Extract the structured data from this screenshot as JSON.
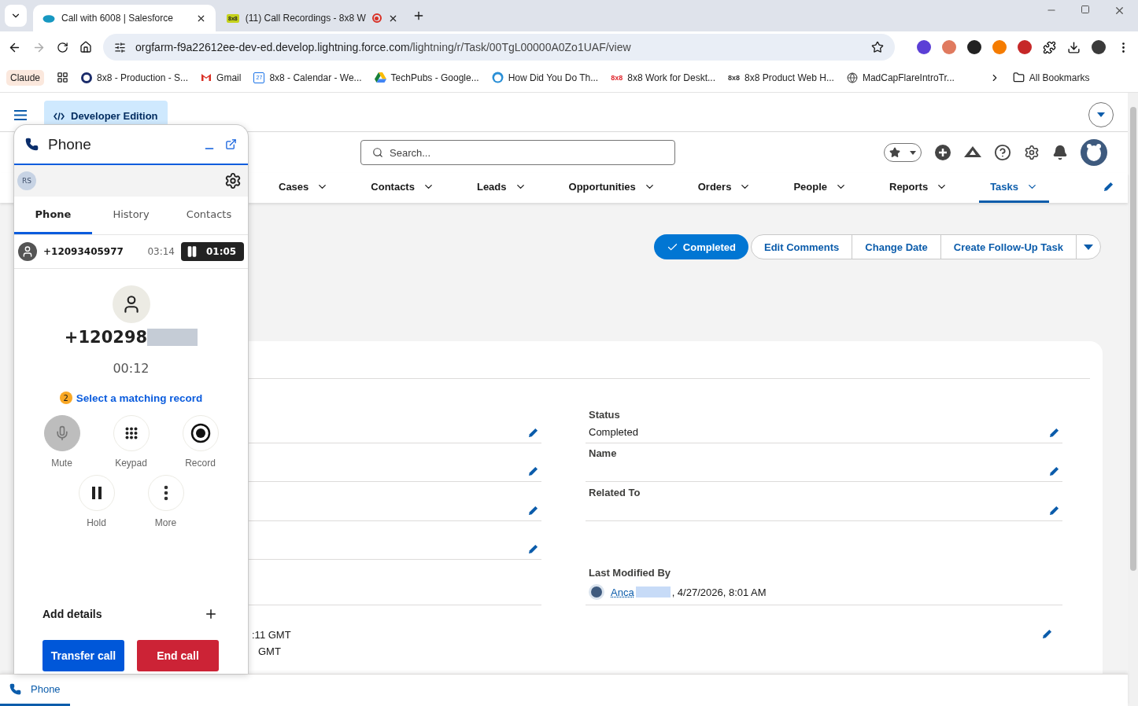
{
  "browser": {
    "tabs": [
      {
        "title": "Call with 6008 | Salesforce",
        "selected": true,
        "kind": "cloud",
        "recording": false
      },
      {
        "title": "(11) Call Recordings - 8x8 W",
        "selected": false,
        "kind": "logo",
        "logo_text": "8x8",
        "recording": true
      }
    ],
    "url": {
      "host": "orgfarm-f9a22612ee-dev-ed.develop.lightning.force.com",
      "path": "/lightning/r/Task/00TgL00000A0Zo1UAF/view"
    },
    "pinned": "Claude",
    "bookmarks": [
      {
        "title": "8x8 - Production - S...",
        "kind": "ring"
      },
      {
        "title": "Gmail",
        "kind": "mail"
      },
      {
        "title": "8x8 - Calendar - We...",
        "kind": "calendar",
        "icon_text": "27"
      },
      {
        "title": "TechPubs - Google...",
        "kind": "drive"
      },
      {
        "title": "How Did You Do Th...",
        "kind": "face"
      },
      {
        "title": "8x8 Work for Deskt...",
        "kind": "text",
        "icon_text": "8x8",
        "color": "#e0282e"
      },
      {
        "title": "8x8 Product Web H...",
        "kind": "text",
        "icon_text": "8x8",
        "color": "#333333"
      },
      {
        "title": "MadCapFlareIntroTr...",
        "kind": "globe"
      }
    ],
    "all_bookmarks": "All Bookmarks"
  },
  "app": {
    "badge": "Developer Edition",
    "search": {
      "placeholder": "Search..."
    },
    "nav": [
      {
        "label": "Cases",
        "selected": false
      },
      {
        "label": "Contacts",
        "selected": false
      },
      {
        "label": "Leads",
        "selected": false
      },
      {
        "label": "Opportunities",
        "selected": false
      },
      {
        "label": "Orders",
        "selected": false
      },
      {
        "label": "People",
        "selected": false
      },
      {
        "label": "Reports",
        "selected": false
      },
      {
        "label": "Tasks",
        "selected": true
      }
    ],
    "actions": [
      {
        "label": "Completed",
        "kind": "primary"
      },
      {
        "label": "Edit Comments",
        "kind": "outline"
      },
      {
        "label": "Change Date",
        "kind": "outline"
      },
      {
        "label": "Create Follow-Up Task",
        "kind": "outline"
      }
    ],
    "rows": [
      {
        "left": {
          "editable": true
        },
        "right": {
          "label": "Status",
          "value": "Completed",
          "editable": true
        }
      },
      {
        "left": {
          "editable": true
        },
        "right": {
          "label": "Name",
          "editable": true
        }
      },
      {
        "left": {
          "editable": true
        },
        "right": {
          "label": "Related To",
          "editable": true
        }
      },
      {
        "left": {
          "editable": true
        }
      },
      {
        "left": {
          "editable": false
        },
        "right": {
          "label": "Last Modified By",
          "user": "Anca",
          "date": ", 4/27/2026, 8:01 AM",
          "editable": false
        }
      }
    ],
    "dates": {
      "lines": [
        ":11 GMT",
        "GMT"
      ],
      "editable": true
    },
    "utility": [
      {
        "label": "Phone",
        "selected": true
      }
    ]
  },
  "phone": {
    "title": "Phone",
    "initials": "RS",
    "tabs": [
      {
        "label": "Phone",
        "selected": true
      },
      {
        "label": "History",
        "selected": false
      },
      {
        "label": "Contacts",
        "selected": false
      }
    ],
    "active_call": {
      "number": "+12093405977",
      "duration": "03:14",
      "hold_time": "01:05",
      "on_hold": true
    },
    "caller": {
      "number": "+120298",
      "timer": "00:12",
      "matches": "2",
      "match_link": "Select a matching record"
    },
    "controls": [
      {
        "label": "Mute",
        "kind": "mic",
        "active": true
      },
      {
        "label": "Keypad",
        "kind": "keypad",
        "active": false
      },
      {
        "label": "Record",
        "kind": "record",
        "active": false
      },
      {
        "label": "Hold",
        "kind": "hold",
        "active": false
      },
      {
        "label": "More",
        "kind": "more",
        "active": false
      }
    ],
    "add_details": "Add details",
    "buttons": [
      {
        "label": "Transfer call",
        "kind": "transfer"
      },
      {
        "label": "End call",
        "kind": "end"
      }
    ]
  }
}
